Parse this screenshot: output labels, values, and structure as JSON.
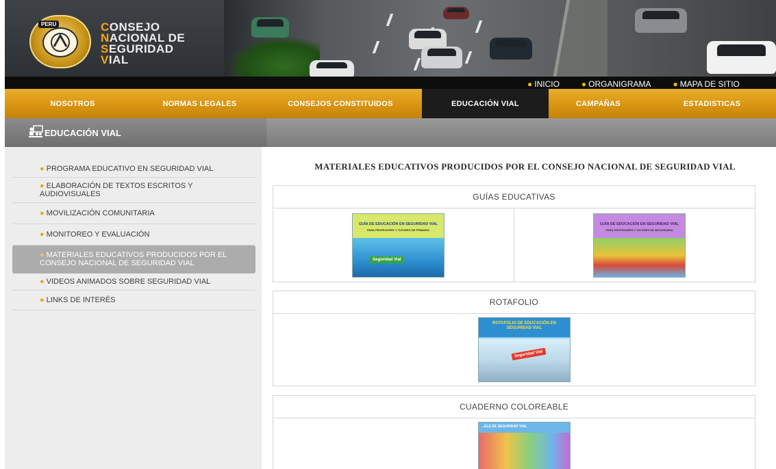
{
  "header": {
    "logo_badge": "PERU",
    "brand_lines": [
      {
        "first": "C",
        "rest": "ONSEJO"
      },
      {
        "first": "N",
        "rest": "ACIONAL DE"
      },
      {
        "first": "S",
        "rest": "EGURIDAD"
      },
      {
        "first": "V",
        "rest": "IAL"
      }
    ],
    "top_links": [
      "INICIO",
      "ORGANIGRAMA",
      "MAPA DE SITIO"
    ]
  },
  "main_menu": [
    "NOSOTROS",
    "NORMAS LEGALES",
    "CONSEJOS CONSTITUIDOS",
    "EDUCACIÓN VIAL",
    "CAMPAÑAS",
    "ESTADISTICAS"
  ],
  "main_menu_active": "EDUCACIÓN VIAL",
  "section": {
    "title": "EDUCACIÓN VIAL"
  },
  "sidebar": {
    "items": [
      "PROGRAMA EDUCATIVO EN SEGURIDAD VIAL",
      "ELABORACIÓN DE TEXTOS ESCRITOS Y AUDIOVISUALES",
      "MOVILIZACIÓN COMUNITARIA",
      "MONITOREO Y EVALUACIÓN",
      "MATERIALES EDUCATIVOS PRODUCIDOS POR EL CONSEJO NACIONAL DE SEGURIDAD VIAL",
      "VIDEOS ANIMADOS SOBRE SEGURIDAD VIAL",
      "LINKS DE INTERÉS"
    ],
    "active_index": 4
  },
  "content": {
    "heading": "MATERIALES EDUCATIVOS PRODUCIDOS POR EL CONSEJO NACIONAL DE SEGURIDAD VIAL",
    "panels": [
      {
        "title": "GUÍAS EDUCATIVAS",
        "covers": [
          {
            "title": "GUÍA DE EDUCACIÓN EN SEGURIDAD VIAL",
            "subtitle": "PARA PROFESORES Y TUTORES DE PRIMARIA",
            "badge": "Seguridad Vial",
            "color": "#2ea8d8"
          },
          {
            "title": "GUÍA DE EDUCACIÓN EN SEGURIDAD VIAL",
            "subtitle": "PARA PROFESORES Y TUTORES DE SECUNDARIA",
            "color": "#b06ad0"
          }
        ]
      },
      {
        "title": "ROTAFOLIO",
        "covers": [
          {
            "title": "ROTAFOLIO DE EDUCACIÓN EN SEGURIDAD VIAL",
            "badge": "Seguridad Vial",
            "color": "#2ea8d8"
          }
        ]
      },
      {
        "title": "CUADERNO COLOREABLE",
        "covers": [
          {
            "title": "...ele de Seguridad Vial",
            "color": "#6fb6e8"
          }
        ]
      }
    ]
  },
  "colors": {
    "menu_gold": "#d99512",
    "menu_active": "#1c1c1c",
    "bullet_orange": "#f3a21a",
    "sidebar_bg": "#ededed",
    "sidebar_active": "#acacac"
  }
}
